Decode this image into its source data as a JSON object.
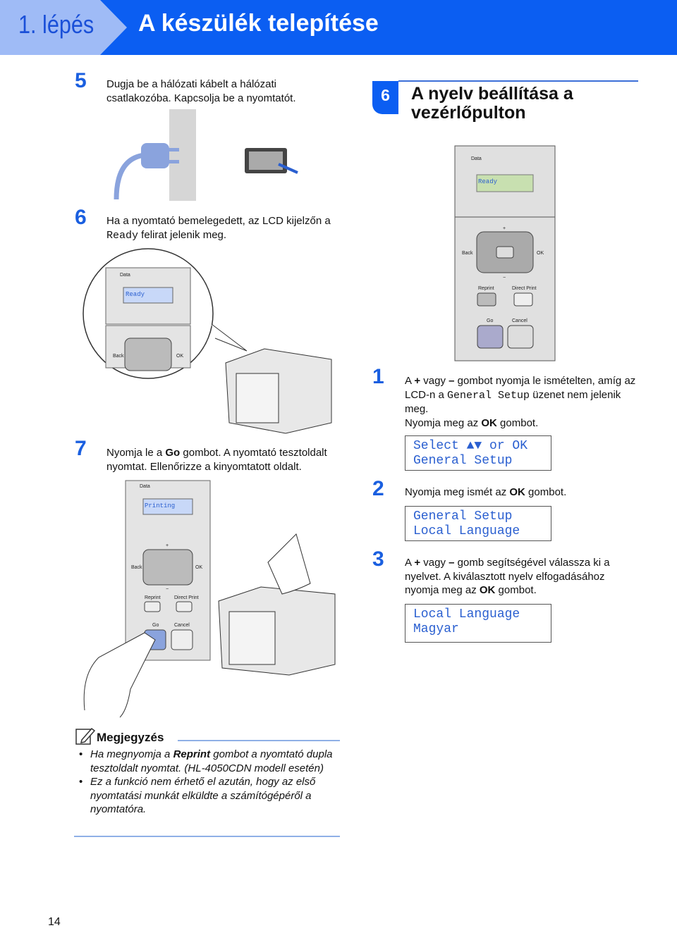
{
  "header": {
    "step": "1. lépés",
    "title": "A készülék telepítése",
    "colors": {
      "step_bg": "#9fbbf6",
      "title_bg": "#0b5ef2"
    }
  },
  "left": {
    "step5": {
      "num": "5",
      "text": "Dugja be a hálózati kábelt a hálózati csatlakozóba. Kapcsolja be a nyomtatót."
    },
    "step6": {
      "num": "6",
      "text_a": "Ha a nyomtató bemelegedett, az LCD kijelzőn a ",
      "text_mono": "Ready",
      "text_b": " felirat jelenik meg."
    },
    "step7": {
      "num": "7",
      "t1": "Nyomja le a ",
      "b1": "Go",
      "t2": " gombot. A nyomtató tesztoldalt nyomtat. Ellenőrizze a kinyomtatott oldalt."
    }
  },
  "panel_labels": {
    "data": "Data",
    "ready": "Ready",
    "printing": "Printing",
    "back": "Back",
    "ok": "OK",
    "reprint": "Reprint",
    "direct_print": "Direct Print",
    "go": "Go",
    "cancel": "Cancel",
    "plus": "+",
    "minus": "−"
  },
  "section6": {
    "num": "6",
    "title": "A nyelv beállítása a vezérlőpulton",
    "steps": [
      {
        "num": "1",
        "t1": "A ",
        "b1": "+",
        "t2": " vagy ",
        "b2": "–",
        "t3": " gombot nyomja le ismételten, amíg az LCD-n a ",
        "mono": "General Setup",
        "t4": " üzenet nem jelenik meg.",
        "t5": "Nyomja meg az ",
        "b3": "OK",
        "t6": " gombot.",
        "lcd": [
          "Select ▲▼ or OK",
          "General Setup"
        ]
      },
      {
        "num": "2",
        "t1": "Nyomja meg ismét az ",
        "b1": "OK",
        "t2": " gombot.",
        "lcd": [
          "General Setup",
          "Local Language"
        ]
      },
      {
        "num": "3",
        "t1": "A ",
        "b1": "+",
        "t2": " vagy ",
        "b2": "–",
        "t3": " gomb segítségével válassza ki a nyelvet. A kiválasztott nyelv elfogadásához nyomja meg az ",
        "b3": "OK",
        "t4": " gombot.",
        "lcd": [
          "Local Language",
          "Magyar"
        ]
      }
    ]
  },
  "note": {
    "title": "Megjegyzés",
    "icon": "note-pencil-icon",
    "items": [
      {
        "t1": "Ha megnyomja a ",
        "b1": "Reprint",
        "t2": " gombot a nyomtató dupla tesztoldalt nyomtat. (HL-4050CDN modell esetén)"
      },
      {
        "t1": "Ez a funkció nem érhető el azután, hogy az első nyomtatási munkát elküldte a számítógépéről a nyomtatóra."
      }
    ]
  },
  "footer": {
    "page_number": "14"
  }
}
